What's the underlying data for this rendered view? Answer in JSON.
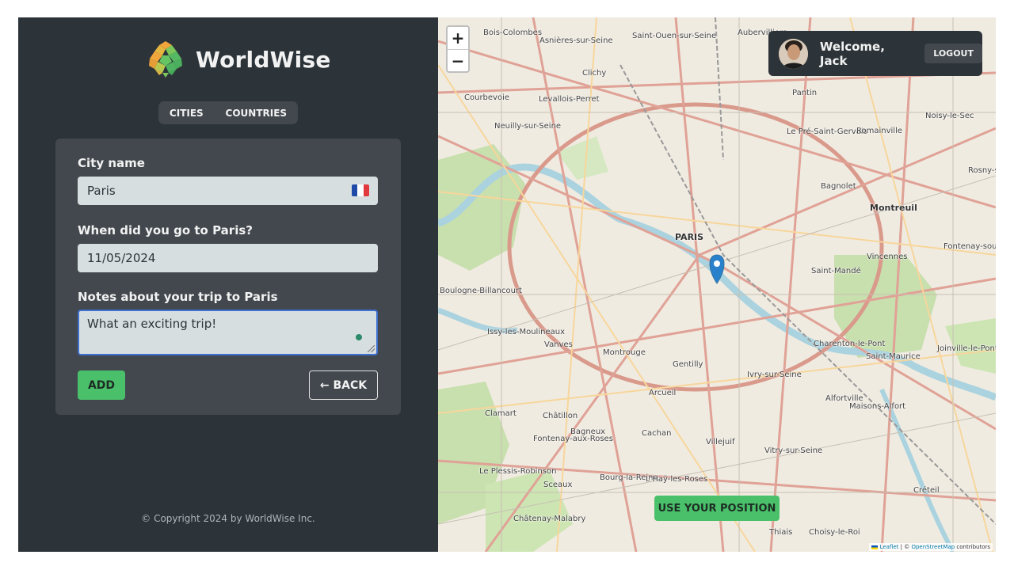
{
  "brand": {
    "name": "WorldWise"
  },
  "tabs": [
    {
      "label": "CITIES"
    },
    {
      "label": "COUNTRIES"
    }
  ],
  "form": {
    "city_label": "City name",
    "city_value": "Paris",
    "city_flag": "france-flag",
    "date_label": "When did you go to Paris?",
    "date_value": "11/05/2024",
    "notes_label": "Notes about your trip to Paris",
    "notes_value": "What an exciting trip!",
    "add_label": "ADD",
    "back_label": "← BACK"
  },
  "footer": {
    "copyright": "© Copyright 2024 by WorldWise Inc."
  },
  "map": {
    "zoom_in": "+",
    "zoom_out": "−",
    "user": {
      "welcome": "Welcome, Jack",
      "logout": "LOGOUT"
    },
    "position_button": "USE YOUR POSITION",
    "attribution": {
      "leaflet": "Leaflet",
      "sep": " | © ",
      "osm": "OpenStreetMap",
      "suffix": " contributors"
    },
    "place_labels": [
      "Bois-Colombes",
      "Asnières-sur-Seine",
      "Saint-Ouen-sur-Seine",
      "Aubervilliers",
      "Clichy",
      "Courbevoie",
      "Levallois-Perret",
      "Neuilly-sur-Seine",
      "Pantin",
      "Le Pré-Saint-Gervais",
      "Romainville",
      "Noisy-le-Sec",
      "Bagnolet",
      "Montreuil",
      "PARIS",
      "Vincennes",
      "Saint-Mandé",
      "Fontenay-sous-Bois",
      "Rosny-s",
      "Boulogne-Billancourt",
      "Issy-les-Moulineaux",
      "Vanves",
      "Montrouge",
      "Gentilly",
      "Ivry-sur-Seine",
      "Charenton-le-Pont",
      "Saint-Maurice",
      "Joinville-le-Pont",
      "Arcueil",
      "Alfortville",
      "Maisons-Alfort",
      "Clamart",
      "Châtillon",
      "Bagneux",
      "Cachan",
      "Villejuif",
      "Fontenay-aux-Roses",
      "Vitry-sur-Seine",
      "Le Plessis-Robinson",
      "Sceaux",
      "Bourg-la-Reine",
      "L'Haÿ-les-Roses",
      "Créteil",
      "Châtenay-Malabry",
      "Thiais",
      "Choisy-le-Roi"
    ]
  },
  "colors": {
    "sidebar": "#2d3439",
    "panel": "#42484d",
    "accent_green": "#4ac06a",
    "field": "#d6dee0"
  }
}
